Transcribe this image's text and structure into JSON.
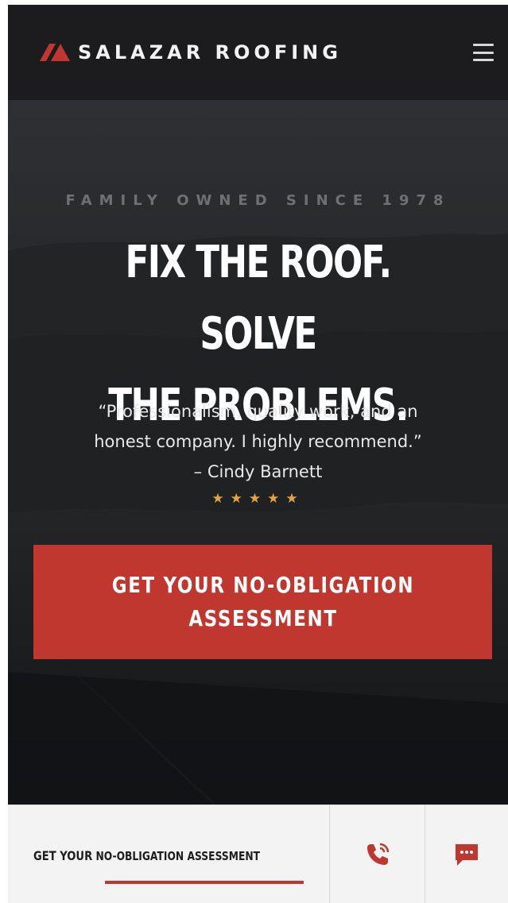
{
  "header": {
    "brand_name": "SALAZAR ROOFING",
    "logo_icon": "roof-logo-icon",
    "menu_icon": "hamburger-menu-icon"
  },
  "hero": {
    "eyebrow": "FAMILY OWNED SINCE 1978",
    "headline_line1": "FIX THE ROOF. SOLVE",
    "headline_line2": "THE PROBLEMS.",
    "quote_line1": "“Professionalism, quality work, and an",
    "quote_line2": "honest company. I highly recommend.”",
    "quote_author": "– Cindy Barnett",
    "rating_stars": "★★★★★",
    "rating_value": 5,
    "cta_line1": "GET YOUR NO-OBLIGATION",
    "cta_line2": "ASSESSMENT"
  },
  "bottom_bar": {
    "cta_prefix": "GET YOUR",
    "cta_main": "NO-OBLIGATION ASSESSMENT",
    "phone_icon": "phone-call-icon",
    "chat_icon": "chat-message-icon"
  },
  "colors": {
    "accent": "#c0372f",
    "header_bg": "#1c1c1f",
    "star": "#e8a33a"
  }
}
